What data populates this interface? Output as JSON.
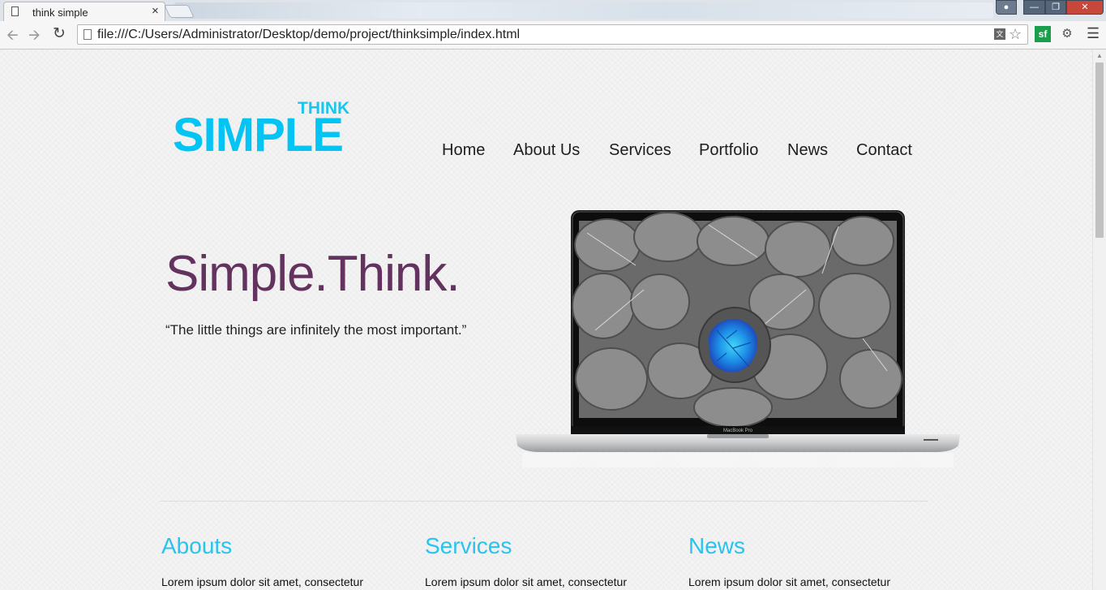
{
  "browser": {
    "tab_title": "think simple",
    "tab_close": "×",
    "url": "file:///C:/Users/Administrator/Desktop/demo/project/thinksimple/index.html",
    "extension_label": "sf",
    "icons": [
      "back-icon",
      "forward-icon",
      "reload-icon",
      "page-icon",
      "translate-icon",
      "star-icon",
      "puzzle-icon",
      "menu-icon"
    ]
  },
  "site": {
    "logo_top": "THINK",
    "logo_main": "SIMPLE",
    "nav": [
      "Home",
      "About Us",
      "Services",
      "Portfolio",
      "News",
      "Contact"
    ],
    "hero_title": "Simple.Think.",
    "hero_quote": "“The little things are infinitely the most important.”",
    "laptop_brand": "MacBook Pro",
    "columns": [
      {
        "heading": "Abouts",
        "text": "Lorem ipsum dolor sit amet, consectetur"
      },
      {
        "heading": "Services",
        "text": "Lorem ipsum dolor sit amet, consectetur"
      },
      {
        "heading": "News",
        "text": "Lorem ipsum dolor sit amet, consectetur"
      }
    ]
  },
  "colors": {
    "logo": "#04c4f4",
    "hero_title": "#63325f",
    "section_heading": "#29c3ef",
    "leaf_highlight": "#1fb8ee"
  }
}
